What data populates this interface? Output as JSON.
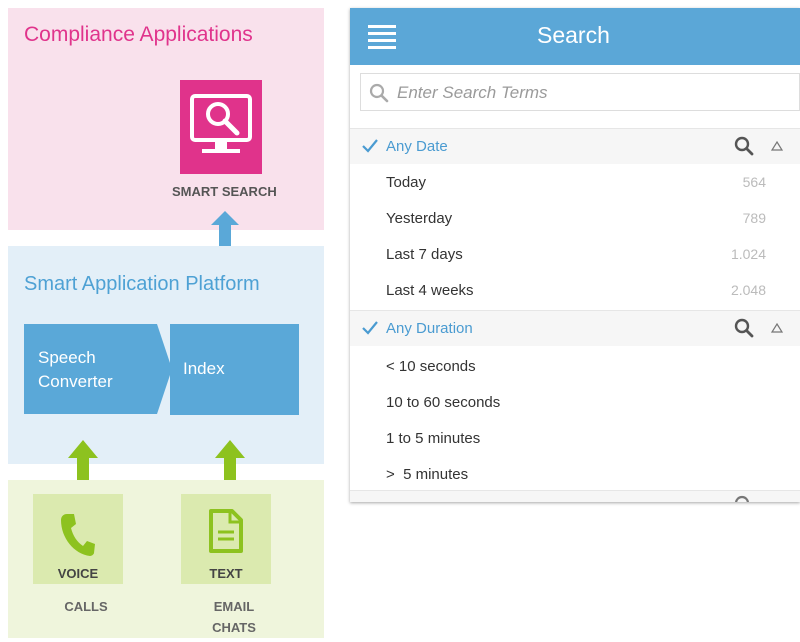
{
  "diagram": {
    "compliance": {
      "title": "Compliance Applications",
      "app_label": "SMART SEARCH"
    },
    "platform": {
      "title": "Smart Application Platform",
      "speech_line1": "Speech",
      "speech_line2": "Converter",
      "index": "Index"
    },
    "sources": [
      {
        "name": "VOICE",
        "sub1": "CALLS",
        "sub2": ""
      },
      {
        "name": "TEXT",
        "sub1": "EMAIL",
        "sub2": "CHATS"
      }
    ],
    "colors": {
      "pink": "#e0338b",
      "blue": "#5aa8d8",
      "green": "#8dc21f"
    }
  },
  "search": {
    "title": "Search",
    "placeholder": "Enter Search Terms",
    "filters": [
      {
        "label": "Any Date",
        "items": [
          {
            "label": "Today",
            "count": "564"
          },
          {
            "label": "Yesterday",
            "count": "789"
          },
          {
            "label": "Last 7 days",
            "count": "1.024"
          },
          {
            "label": "Last 4 weeks",
            "count": "2.048"
          }
        ]
      },
      {
        "label": "Any Duration",
        "items": [
          {
            "label": "< 10 seconds"
          },
          {
            "label": "10 to 60 seconds"
          },
          {
            "label": "1 to 5 minutes"
          },
          {
            "label": ">  5 minutes"
          }
        ]
      }
    ]
  }
}
